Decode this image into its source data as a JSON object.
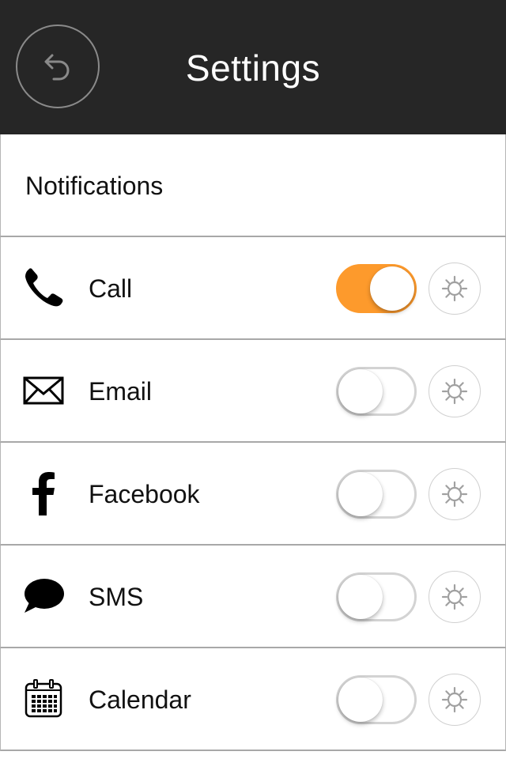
{
  "header": {
    "title": "Settings",
    "back_icon": "undo-arrow-icon"
  },
  "section": {
    "title": "Notifications"
  },
  "rows": [
    {
      "label": "Call",
      "icon": "phone-icon",
      "enabled": true
    },
    {
      "label": "Email",
      "icon": "envelope-icon",
      "enabled": false
    },
    {
      "label": "Facebook",
      "icon": "facebook-icon",
      "enabled": false
    },
    {
      "label": "SMS",
      "icon": "speech-bubble-icon",
      "enabled": false
    },
    {
      "label": "Calendar",
      "icon": "calendar-icon",
      "enabled": false
    }
  ],
  "colors": {
    "header_bg": "#262626",
    "toggle_on": "#fd9a2c",
    "toggle_off_border": "#d3d3d3"
  }
}
